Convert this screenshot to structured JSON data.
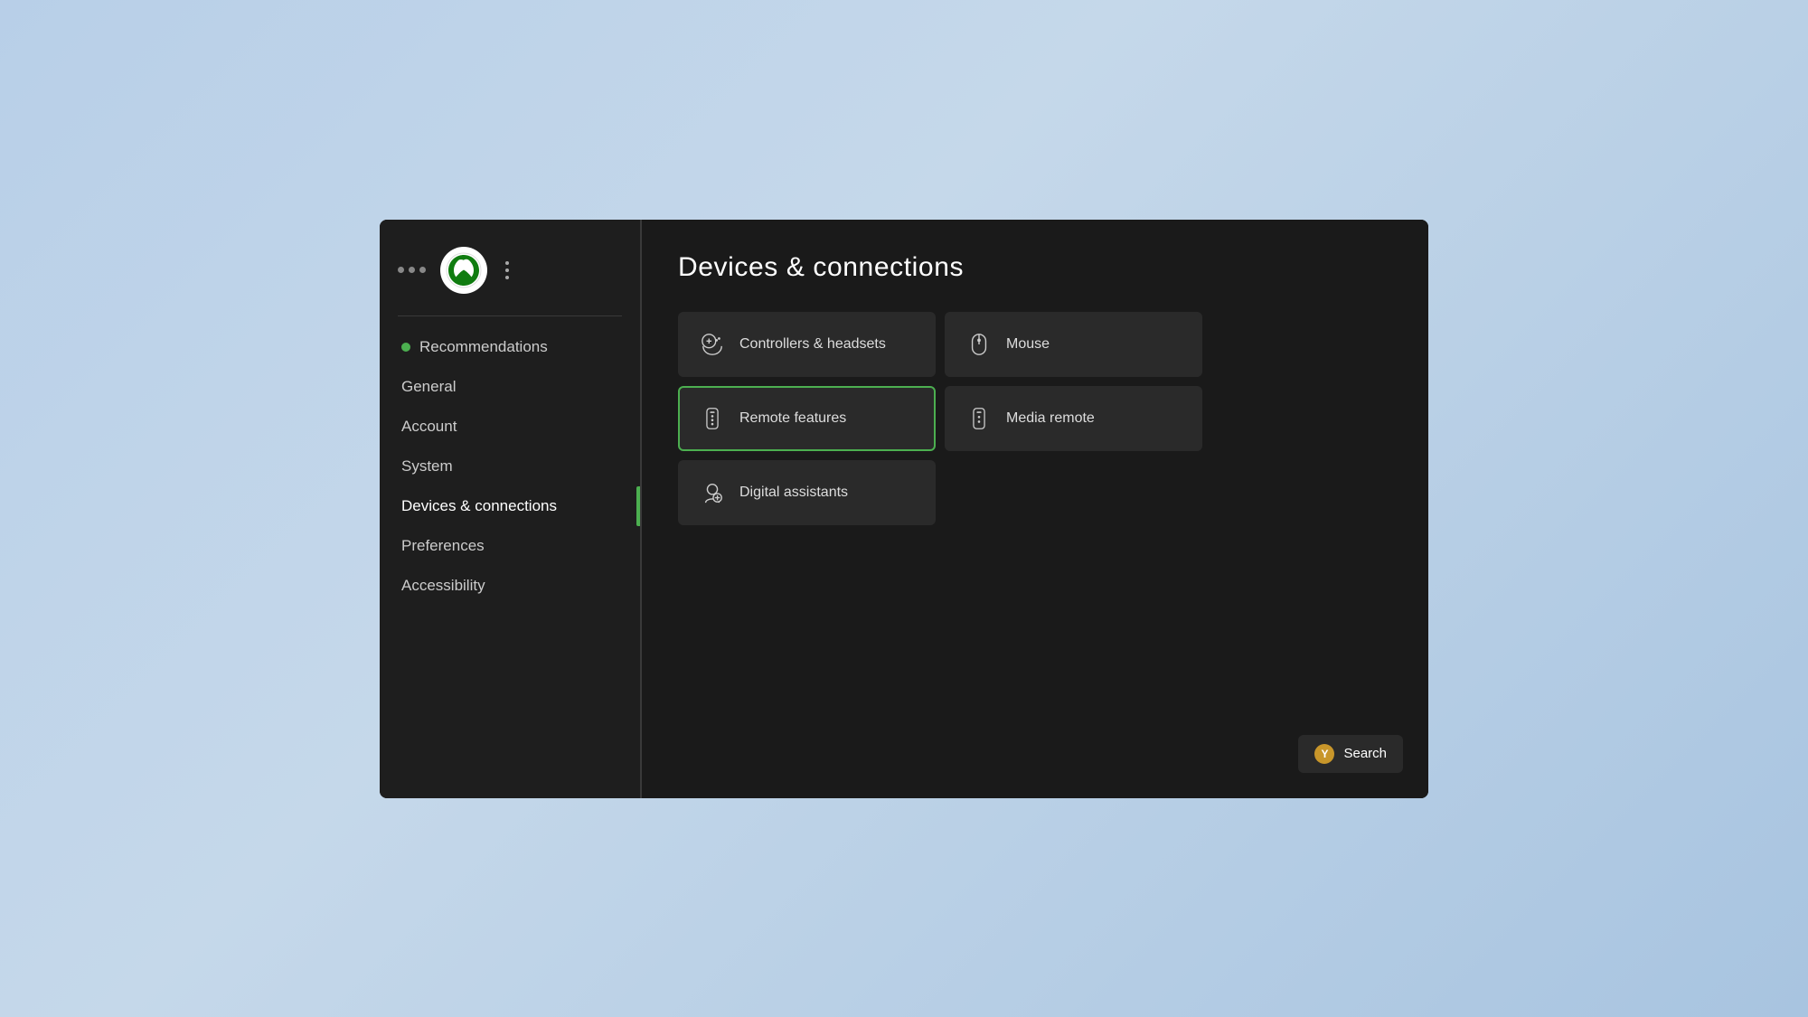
{
  "window": {
    "title": "Devices & connections"
  },
  "sidebar": {
    "logo_alt": "Xbox logo",
    "nav_items": [
      {
        "id": "recommendations",
        "label": "Recommendations",
        "has_dot": true,
        "active": false
      },
      {
        "id": "general",
        "label": "General",
        "has_dot": false,
        "active": false
      },
      {
        "id": "account",
        "label": "Account",
        "has_dot": false,
        "active": false
      },
      {
        "id": "system",
        "label": "System",
        "has_dot": false,
        "active": false
      },
      {
        "id": "devices-connections",
        "label": "Devices & connections",
        "has_dot": false,
        "active": true
      },
      {
        "id": "preferences",
        "label": "Preferences",
        "has_dot": false,
        "active": false
      },
      {
        "id": "accessibility",
        "label": "Accessibility",
        "has_dot": false,
        "active": false
      }
    ]
  },
  "main": {
    "page_title": "Devices & connections",
    "grid_items": [
      {
        "id": "controllers-headsets",
        "label": "Controllers & headsets",
        "icon": "controller-icon",
        "selected": false
      },
      {
        "id": "mouse",
        "label": "Mouse",
        "icon": "mouse-icon",
        "selected": false
      },
      {
        "id": "remote-features",
        "label": "Remote features",
        "icon": "remote-icon",
        "selected": true
      },
      {
        "id": "media-remote",
        "label": "Media remote",
        "icon": "media-remote-icon",
        "selected": false
      },
      {
        "id": "digital-assistants",
        "label": "Digital assistants",
        "icon": "assistant-icon",
        "selected": false
      }
    ]
  },
  "search_button": {
    "label": "Search",
    "y_label": "Y"
  }
}
